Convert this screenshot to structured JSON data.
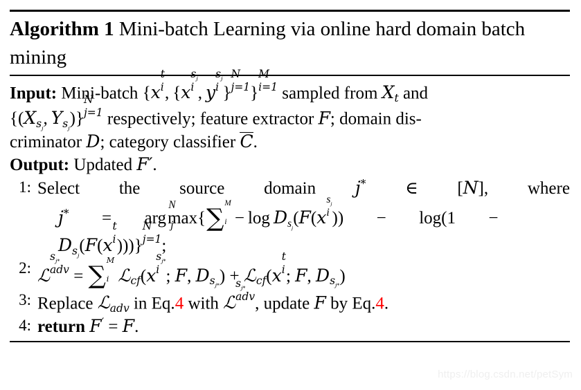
{
  "document": {
    "kind": "latex-algorithm-block",
    "watermark": "https://blog.csdn.net/petSym"
  },
  "title": {
    "keyword": "Algorithm 1",
    "caption": "Mini-batch Learning via online hard domain batch mining"
  },
  "io": {
    "input_label": "Input:",
    "input_text_1": "Mini-batch",
    "input_text_2": "sampled from",
    "input_text_3": "and",
    "input_text_4": "respectively;  feature extractor",
    "input_text_5": ";  domain dis-",
    "input_text_6": "criminator",
    "input_text_7": "; category classifier",
    "input_text_8": ".",
    "output_label": "Output:",
    "output_text": "Updated",
    "output_symbol": "F′",
    "output_period": "."
  },
  "steps": [
    {
      "num": "1:",
      "words": [
        "Select",
        "the",
        "source",
        "domain"
      ],
      "tail_words": [
        "where"
      ],
      "relation": "∈",
      "set": "[N],",
      "continuation_note": "argmax expression over j"
    },
    {
      "num": "2:",
      "label": "loss-definition"
    },
    {
      "num": "3:",
      "t1": "Replace",
      "t2": "in",
      "t3": "Eq.",
      "t4": "4",
      "t5": "with",
      "t6": ", update",
      "t7": "by",
      "t8": "Eq.",
      "t9": "4",
      "t10": "."
    },
    {
      "num": "4:",
      "keyword": "return",
      "expr": "F′ = F."
    }
  ],
  "math": {
    "x": "x",
    "y": "y",
    "X": "X",
    "Y": "Y",
    "F": "F",
    "D": "D",
    "N": "N",
    "M": "M",
    "C": "C",
    "j_star": "j*",
    "t": "t",
    "i": "i",
    "j": "j",
    "s_j": "sj",
    "sub_i": "i",
    "sub_j_eq_1": "j=1",
    "sub_i_eq_1": "i=1",
    "log": "log",
    "arg": "arg",
    "max": "max",
    "adv": "adv",
    "cf": "cf",
    "one": "1",
    "L": "ℒ",
    "sum": "∑",
    "in": "∈",
    "minus": "−",
    "plus": "+",
    "equals": "=",
    "semicolon": ";",
    "comma": ",",
    "lbrack": "[",
    "rbrack": "]",
    "lbrace": "{",
    "rbrace": "}",
    "lparen": "(",
    "rparen": ")",
    "star": "*",
    "prime": "′"
  },
  "colors": {
    "text": "#000000",
    "eq_reference": "#ff0000",
    "watermark": "#efefef",
    "background": "#ffffff"
  }
}
